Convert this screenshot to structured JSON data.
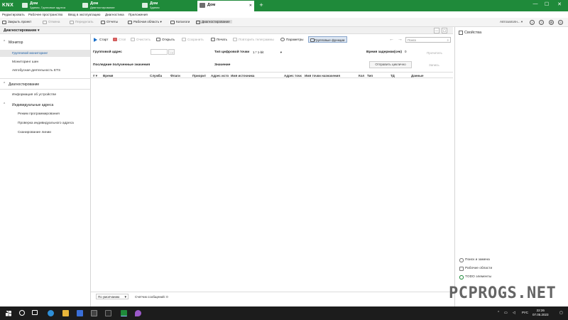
{
  "app": {
    "logo": "KNX",
    "tabs": [
      {
        "title": "Дом",
        "subtitle": "Здания, Групповые адреса",
        "active": false
      },
      {
        "title": "Дом",
        "subtitle": "Диагностирование",
        "active": false
      },
      {
        "title": "Дом",
        "subtitle": "Здания",
        "active": false
      },
      {
        "title": "Дом",
        "subtitle": "",
        "active": true
      }
    ],
    "new_tab": "+",
    "window_controls": {
      "minimize": "—",
      "maximize": "☐",
      "close": "✕"
    }
  },
  "menubar": {
    "items": [
      "Редактировать",
      "Рабочее пространство",
      "Ввод в эксплуатацию",
      "Диагностика",
      "Приложения"
    ]
  },
  "toolbar": {
    "close_project": "Закрыть проект",
    "undo": "Отмена",
    "redo": "Переделать",
    "reports": "Отчеты",
    "workspace": "Рабочая область",
    "catalogs": "Каталоги",
    "diagnostics": "Диагностирование",
    "autocomplete": "Автозаполн...",
    "round_buttons": [
      "i",
      "?",
      "⚙",
      "☺"
    ]
  },
  "left_panel": {
    "header": "Диагностирование",
    "sections": [
      {
        "label": "Монитор",
        "items": [
          "Групповой мониторинг",
          "Мониторинг шин",
          "Автобусная деятельность ETS"
        ]
      },
      {
        "label": "Диагностирование",
        "items": [
          "Информация об устройстве"
        ]
      },
      {
        "label": "Индивидуальные адреса",
        "items": [
          "Режим программирования",
          "Проверка индивидуального адреса",
          "Сканирование линии"
        ]
      }
    ]
  },
  "main": {
    "toolbar": {
      "start": "Старт",
      "stop": "Стоп",
      "clear": "Очистить",
      "open": "Открыть",
      "save": "Сохранить",
      "print": "Печать",
      "repeat": "Повторить телеграммы",
      "params": "Параметры",
      "group_functions": "Групповые функции"
    },
    "search": {
      "placeholder": "Поиск"
    },
    "form": {
      "group_address_label": "Групповой адрес",
      "last_value_label": "Последние полученные значения",
      "dpt_label": "Тип цифровой точки",
      "dpt_value": "1.* 1-bit",
      "value_label": "Значение",
      "delay_label": "Время задержки(сек)",
      "delay_value": "0",
      "read_btn": "Прочитать",
      "write_btn": "Запись",
      "send_cyclic": "Отправить циклично"
    },
    "columns": [
      "#",
      "Время",
      "Служба",
      "Флаги",
      "Приорит",
      "Адрес исто",
      "Имя источника",
      "Адрес точк",
      "Имя точки назначения",
      "Кол",
      "Тип",
      "ТД",
      "Данные"
    ],
    "status": {
      "filter": "По умолчанию",
      "count_label": "Счетчик сообщений: 0"
    }
  },
  "right_panel": {
    "title": "Свойства",
    "links": [
      "Поиск и замена",
      "Рабочие области",
      "TODO элементы"
    ]
  },
  "watermark": "PCPROGS.NET",
  "taskbar": {
    "lang": "РУС",
    "time": "22:26",
    "date": "07.05.2023"
  },
  "colors": {
    "brand_green": "#1f8a3a",
    "accent_blue": "#1a5fa8",
    "taskbar": "#1c1c1c"
  }
}
